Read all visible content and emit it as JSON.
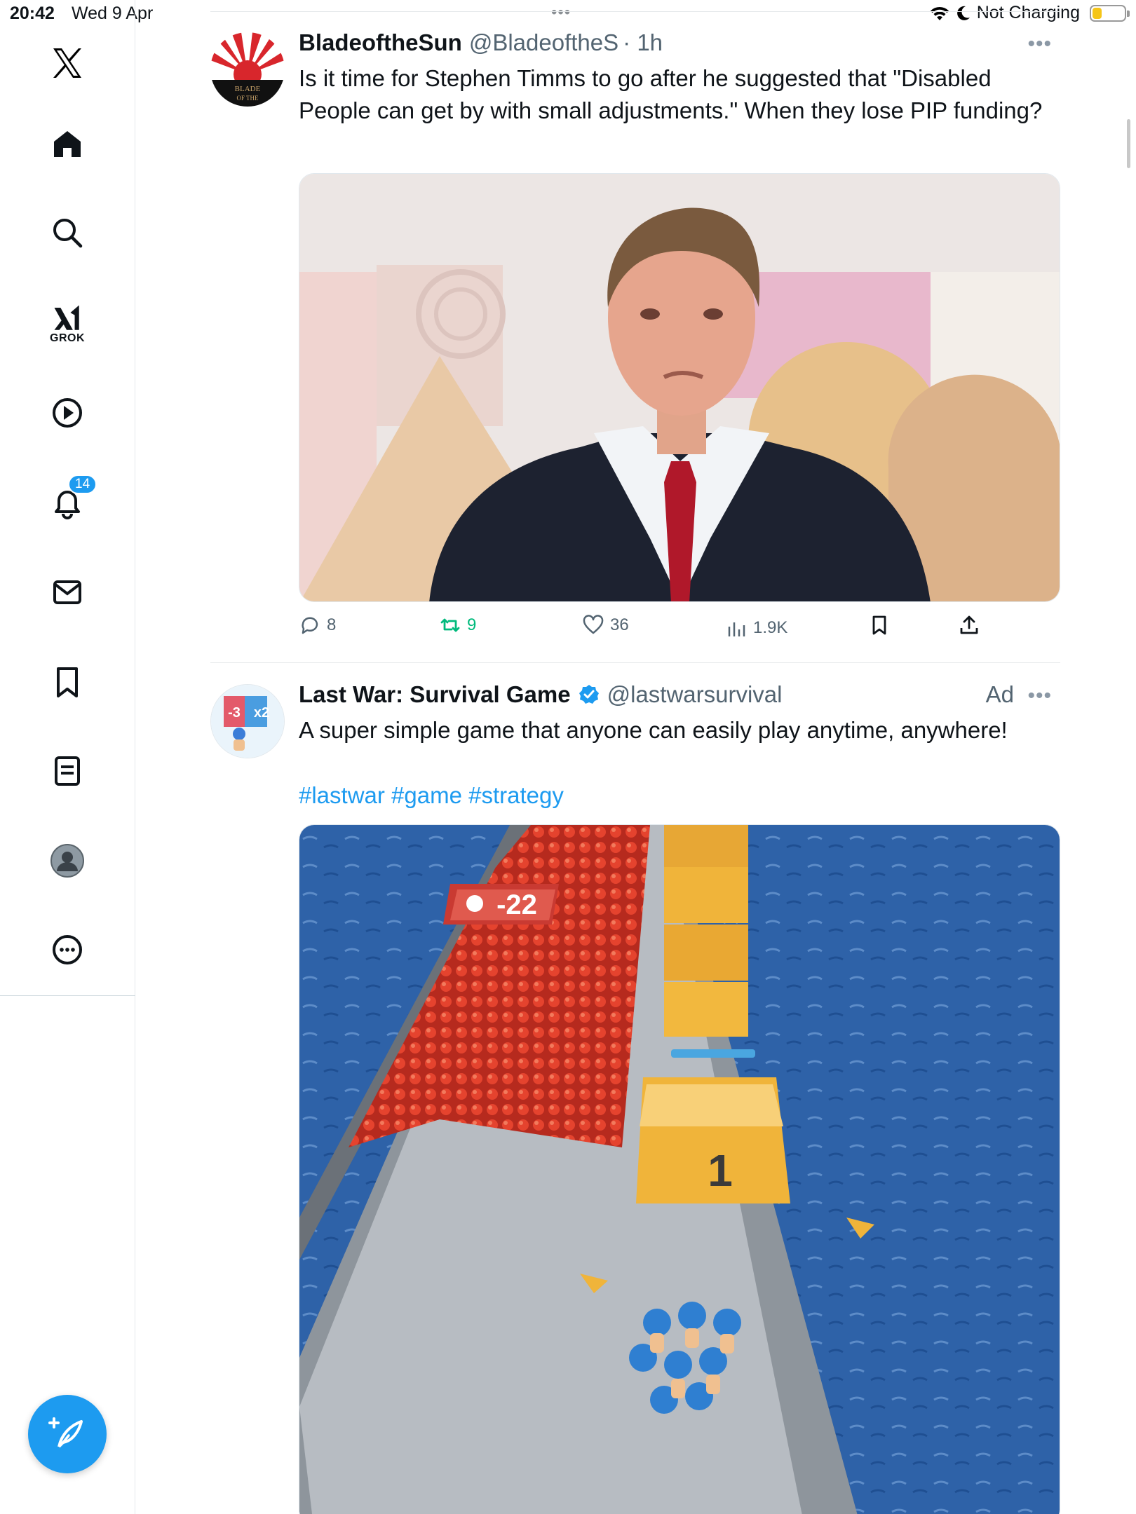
{
  "status_bar": {
    "time": "20:42",
    "date": "Wed 9 Apr",
    "charging": "Not Charging",
    "battery_level": 0.3
  },
  "sidebar": {
    "items": [
      {
        "name": "x-logo",
        "icon": "x-logo-icon"
      },
      {
        "name": "home",
        "icon": "home-icon"
      },
      {
        "name": "explore",
        "icon": "search-icon"
      },
      {
        "name": "grok",
        "icon": "grok-icon",
        "label": "GROK"
      },
      {
        "name": "videos",
        "icon": "play-icon"
      },
      {
        "name": "notifications",
        "icon": "bell-icon",
        "badge": "14"
      },
      {
        "name": "messages",
        "icon": "mail-icon"
      },
      {
        "name": "bookmarks",
        "icon": "bookmark-icon"
      },
      {
        "name": "lists",
        "icon": "list-icon"
      },
      {
        "name": "profile",
        "icon": "avatar-icon"
      },
      {
        "name": "more",
        "icon": "more-icon"
      }
    ],
    "compose_icon": "compose-icon"
  },
  "posts": [
    {
      "name": "BladeoftheSun",
      "handle": "@BladeoftheS",
      "time": "· 1h",
      "text": "Is it time for Stephen Timms to go after he suggested that \"Disabled People can get by with small adjustments.\" When they lose PIP funding?",
      "avatar_text": "BLADE OF THE",
      "stats": {
        "replies": "8",
        "reposts": "9",
        "likes": "36",
        "views": "1.9K"
      }
    },
    {
      "name": "Last War: Survival Game",
      "handle": "@lastwarsurvival",
      "ad": "Ad",
      "text": "A super simple game that anyone can easily play anytime, anywhere!",
      "hashtags": "#lastwar #game #strategy",
      "avatar_text": {
        "minus": "-3",
        "times": "x2"
      },
      "video_overlay": {
        "counter": "-22",
        "gate": "1"
      }
    }
  ],
  "colors": {
    "accent": "#1d9bf0",
    "repost_green": "#00ba7c",
    "text_secondary": "#536471",
    "badge": "#1d9bf0"
  }
}
